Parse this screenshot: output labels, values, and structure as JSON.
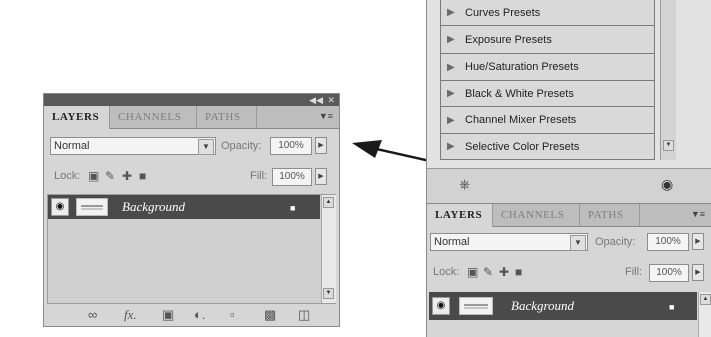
{
  "left_panel": {
    "collapse_icon": "collapse-icon",
    "close_icon": "close-icon",
    "tabs": [
      {
        "label": "LAYERS",
        "active": true
      },
      {
        "label": "CHANNELS",
        "active": false
      },
      {
        "label": "PATHS",
        "active": false
      }
    ],
    "blend_mode": "Normal",
    "opacity_label": "Opacity:",
    "opacity_value": "100%",
    "lock_label": "Lock:",
    "fill_label": "Fill:",
    "fill_value": "100%",
    "layers": [
      {
        "name": "Background",
        "visible": true,
        "locked": true
      }
    ],
    "footer_icons": [
      "link-layers-icon",
      "fx-icon",
      "layer-mask-icon",
      "adjustment-layer-icon",
      "group-folder-icon",
      "new-layer-icon",
      "delete-layer-icon"
    ]
  },
  "right_panel": {
    "presets": [
      "Curves Presets",
      "Exposure Presets",
      "Hue/Saturation Presets",
      "Black & White Presets",
      "Channel Mixer Presets",
      "Selective Color Presets"
    ],
    "tabs": [
      {
        "label": "LAYERS",
        "active": true
      },
      {
        "label": "CHANNELS",
        "active": false
      },
      {
        "label": "PATHS",
        "active": false
      }
    ],
    "blend_mode": "Normal",
    "opacity_label": "Opacity:",
    "opacity_value": "100%",
    "lock_label": "Lock:",
    "fill_label": "Fill:",
    "fill_value": "100%",
    "layers": [
      {
        "name": "Background",
        "visible": true,
        "locked": true
      }
    ]
  },
  "arrow": {
    "direction": "left",
    "color": "#1a1a1a"
  },
  "colors": {
    "panel_bg": "#d6d6d6",
    "titlebar": "#5a5a5a",
    "layer_row": "#4a4a4a",
    "tab_bar": "#bdbdbd"
  }
}
